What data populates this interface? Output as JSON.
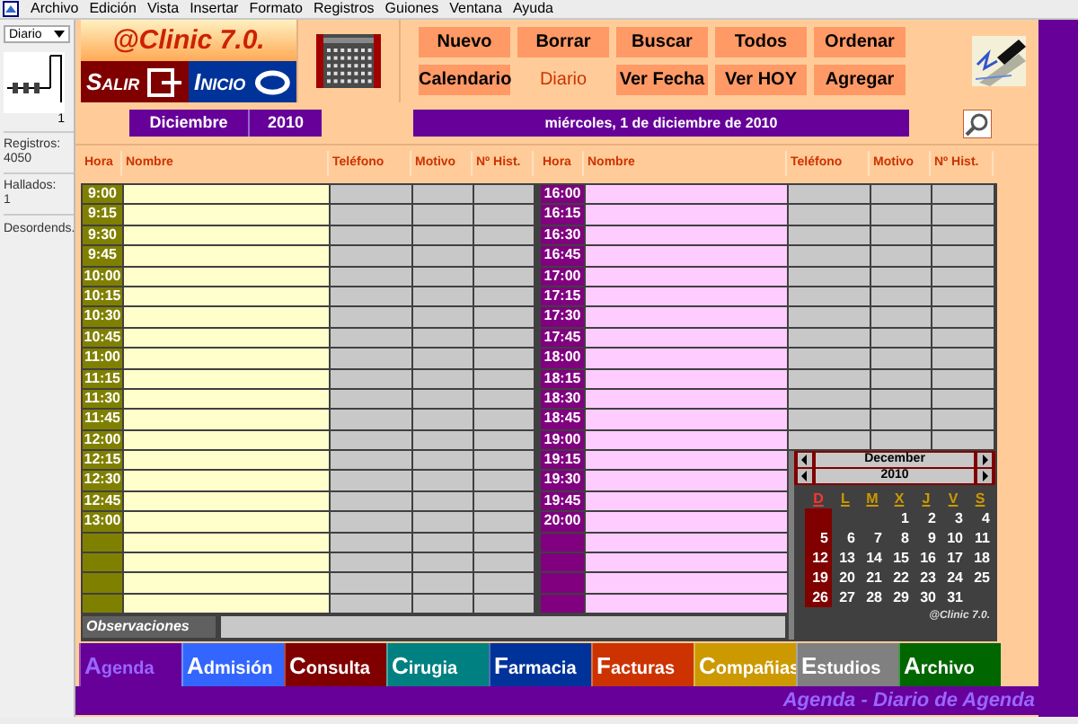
{
  "menu_bar": [
    "Archivo",
    "Edición",
    "Vista",
    "Insertar",
    "Formato",
    "Registros",
    "Guiones",
    "Ventana",
    "Ayuda"
  ],
  "sidebar": {
    "layout_select": "Diario",
    "record_number": "1",
    "stats": [
      {
        "label": "Registros:",
        "value": "4050"
      },
      {
        "label": "Hallados:",
        "value": "1"
      }
    ],
    "sort_status": "Desordends."
  },
  "header": {
    "logo": "@Clinic 7.0.",
    "exit_button": "SALIR",
    "home_button": "INICIO",
    "actions": [
      {
        "label": "Nuevo",
        "selected": false
      },
      {
        "label": "Borrar",
        "selected": false
      },
      {
        "label": "Buscar",
        "selected": false
      },
      {
        "label": "Todos",
        "selected": false
      },
      {
        "label": "Ordenar",
        "selected": false
      },
      {
        "label": "Calendario",
        "selected": false
      },
      {
        "label": "Diario",
        "selected": true
      },
      {
        "label": "Ver Fecha",
        "selected": false
      },
      {
        "label": "Ver HOY",
        "selected": false
      },
      {
        "label": "Agregar",
        "selected": false
      }
    ],
    "month": "Diciembre",
    "year": "2010",
    "date": "miércoles, 1 de diciembre de 2010"
  },
  "morning": {
    "columns": [
      "Hora",
      "Nombre",
      "Teléfono",
      "Motivo",
      "Nº Hist."
    ],
    "slots": [
      "9:00",
      "9:15",
      "9:30",
      "9:45",
      "10:00",
      "10:15",
      "10:30",
      "10:45",
      "11:00",
      "11:15",
      "11:30",
      "11:45",
      "12:00",
      "12:15",
      "12:30",
      "12:45",
      "13:00"
    ]
  },
  "afternoon": {
    "columns": [
      "Hora",
      "Nombre",
      "Teléfono",
      "Motivo",
      "Nº Hist."
    ],
    "slots": [
      "16:00",
      "16:15",
      "16:30",
      "16:45",
      "17:00",
      "17:15",
      "17:30",
      "17:45",
      "18:00",
      "18:15",
      "18:30",
      "18:45",
      "19:00",
      "19:15",
      "19:30",
      "19:45",
      "20:00"
    ]
  },
  "calendar": {
    "month": "December",
    "year": "2010",
    "weekdays": [
      "D",
      "L",
      "M",
      "X",
      "J",
      "V",
      "S"
    ],
    "weeks": [
      [
        "1",
        "2",
        "3",
        "4"
      ],
      [
        "5",
        "6",
        "7",
        "8",
        "9",
        "10",
        "11"
      ],
      [
        "12",
        "13",
        "14",
        "15",
        "16",
        "17",
        "18"
      ],
      [
        "19",
        "20",
        "21",
        "22",
        "23",
        "24",
        "25"
      ],
      [
        "26",
        "27",
        "28",
        "29",
        "30",
        "31"
      ]
    ],
    "footer": "@Clinic 7.0."
  },
  "observations": {
    "label": "Observaciones"
  },
  "tabs": [
    {
      "label": "Agenda",
      "color": "#660099",
      "selected": true
    },
    {
      "label": "Admisión",
      "color": "#3366ff",
      "selected": false
    },
    {
      "label": "Consulta",
      "color": "#800000",
      "selected": false
    },
    {
      "label": "Cirugia",
      "color": "#008080",
      "selected": false
    },
    {
      "label": "Farmacia",
      "color": "#003399",
      "selected": false
    },
    {
      "label": "Facturas",
      "color": "#cc3300",
      "selected": false
    },
    {
      "label": "Compañias",
      "color": "#cc9900",
      "selected": false
    },
    {
      "label": "Estudios",
      "color": "#808080",
      "selected": false
    },
    {
      "label": "Archivo",
      "color": "#006600",
      "selected": false
    }
  ],
  "status_bar": "Agenda - Diario de Agenda"
}
